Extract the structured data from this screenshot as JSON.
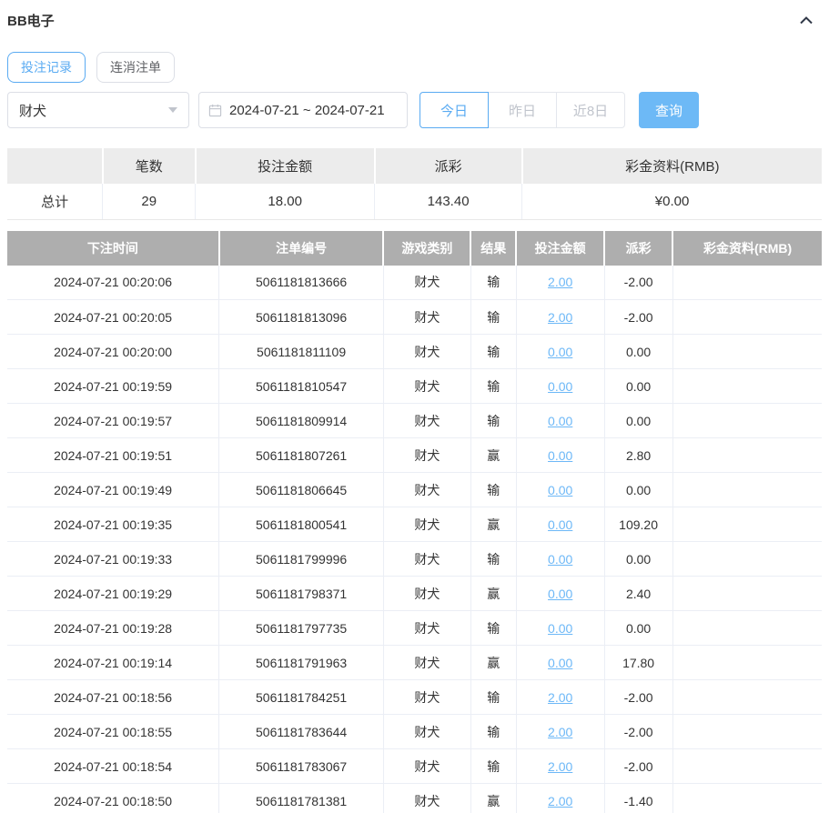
{
  "panel": {
    "title": "BB电子"
  },
  "tabs": [
    {
      "label": "投注记录",
      "active": true
    },
    {
      "label": "连消注单",
      "active": false
    }
  ],
  "filters": {
    "game_select": {
      "value": "财犬"
    },
    "date_range": {
      "value": "2024-07-21 ~ 2024-07-21"
    },
    "quick_buttons": [
      {
        "label": "今日",
        "active": true
      },
      {
        "label": "昨日",
        "active": false
      },
      {
        "label": "近8日",
        "active": false
      }
    ],
    "search_label": "查询"
  },
  "summary_table": {
    "headers": [
      "",
      "笔数",
      "投注金额",
      "派彩",
      "彩金资料(RMB)"
    ],
    "total_row": {
      "label": "总计",
      "count": "29",
      "bet_amount": "18.00",
      "payout": "143.40",
      "bonus": "¥0.00"
    }
  },
  "records_table": {
    "headers": [
      "下注时间",
      "注单编号",
      "游戏类别",
      "结果",
      "投注金额",
      "派彩",
      "彩金资料(RMB)"
    ],
    "rows": [
      {
        "time": "2024-07-21 00:20:06",
        "order_id": "5061181813666",
        "game": "财犬",
        "result": "输",
        "bet": "2.00",
        "payout": "-2.00",
        "bonus": ""
      },
      {
        "time": "2024-07-21 00:20:05",
        "order_id": "5061181813096",
        "game": "财犬",
        "result": "输",
        "bet": "2.00",
        "payout": "-2.00",
        "bonus": ""
      },
      {
        "time": "2024-07-21 00:20:00",
        "order_id": "5061181811109",
        "game": "财犬",
        "result": "输",
        "bet": "0.00",
        "payout": "0.00",
        "bonus": ""
      },
      {
        "time": "2024-07-21 00:19:59",
        "order_id": "5061181810547",
        "game": "财犬",
        "result": "输",
        "bet": "0.00",
        "payout": "0.00",
        "bonus": ""
      },
      {
        "time": "2024-07-21 00:19:57",
        "order_id": "5061181809914",
        "game": "财犬",
        "result": "输",
        "bet": "0.00",
        "payout": "0.00",
        "bonus": ""
      },
      {
        "time": "2024-07-21 00:19:51",
        "order_id": "5061181807261",
        "game": "财犬",
        "result": "赢",
        "bet": "0.00",
        "payout": "2.80",
        "bonus": ""
      },
      {
        "time": "2024-07-21 00:19:49",
        "order_id": "5061181806645",
        "game": "财犬",
        "result": "输",
        "bet": "0.00",
        "payout": "0.00",
        "bonus": ""
      },
      {
        "time": "2024-07-21 00:19:35",
        "order_id": "5061181800541",
        "game": "财犬",
        "result": "赢",
        "bet": "0.00",
        "payout": "109.20",
        "bonus": ""
      },
      {
        "time": "2024-07-21 00:19:33",
        "order_id": "5061181799996",
        "game": "财犬",
        "result": "输",
        "bet": "0.00",
        "payout": "0.00",
        "bonus": ""
      },
      {
        "time": "2024-07-21 00:19:29",
        "order_id": "5061181798371",
        "game": "财犬",
        "result": "赢",
        "bet": "0.00",
        "payout": "2.40",
        "bonus": ""
      },
      {
        "time": "2024-07-21 00:19:28",
        "order_id": "5061181797735",
        "game": "财犬",
        "result": "输",
        "bet": "0.00",
        "payout": "0.00",
        "bonus": ""
      },
      {
        "time": "2024-07-21 00:19:14",
        "order_id": "5061181791963",
        "game": "财犬",
        "result": "赢",
        "bet": "0.00",
        "payout": "17.80",
        "bonus": ""
      },
      {
        "time": "2024-07-21 00:18:56",
        "order_id": "5061181784251",
        "game": "财犬",
        "result": "输",
        "bet": "2.00",
        "payout": "-2.00",
        "bonus": ""
      },
      {
        "time": "2024-07-21 00:18:55",
        "order_id": "5061181783644",
        "game": "财犬",
        "result": "输",
        "bet": "2.00",
        "payout": "-2.00",
        "bonus": ""
      },
      {
        "time": "2024-07-21 00:18:54",
        "order_id": "5061181783067",
        "game": "财犬",
        "result": "输",
        "bet": "2.00",
        "payout": "-2.00",
        "bonus": ""
      },
      {
        "time": "2024-07-21 00:18:50",
        "order_id": "5061181781381",
        "game": "财犬",
        "result": "赢",
        "bet": "2.00",
        "payout": "-1.40",
        "bonus": ""
      }
    ]
  },
  "colors": {
    "accent_blue": "#5aabf2",
    "search_button_blue": "#6db9f6",
    "link_blue": "#6db8f7",
    "negative_red": "#f56c6c",
    "records_header_gray": "#aeaeae",
    "summary_header_gray": "#ececec"
  }
}
